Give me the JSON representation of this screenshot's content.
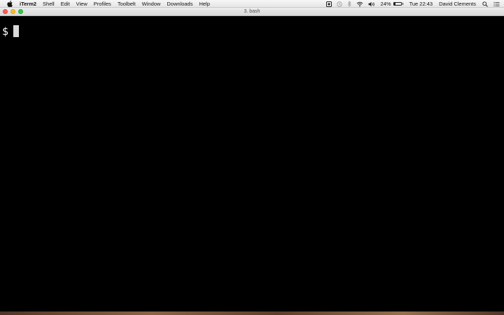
{
  "menubar": {
    "app_name": "iTerm2",
    "items": [
      "Shell",
      "Edit",
      "View",
      "Profiles",
      "Toolbelt",
      "Window",
      "Downloads",
      "Help"
    ],
    "battery_percent": "24%",
    "battery_level": 0.24,
    "clock": "Tue 22:43",
    "user": "David Clements",
    "icons": [
      "apple-icon",
      "record-icon",
      "time-machine-icon",
      "bluetooth-icon",
      "wifi-icon",
      "volume-icon",
      "battery-icon",
      "spotlight-icon",
      "notification-center-icon"
    ]
  },
  "window": {
    "title": "3. bash",
    "prompt": "$"
  },
  "colors": {
    "terminal_bg": "#000000",
    "close": "#fc5f57",
    "minimize": "#fdbc2e",
    "zoom": "#34c84a",
    "cursor": "#d9d9d9"
  }
}
